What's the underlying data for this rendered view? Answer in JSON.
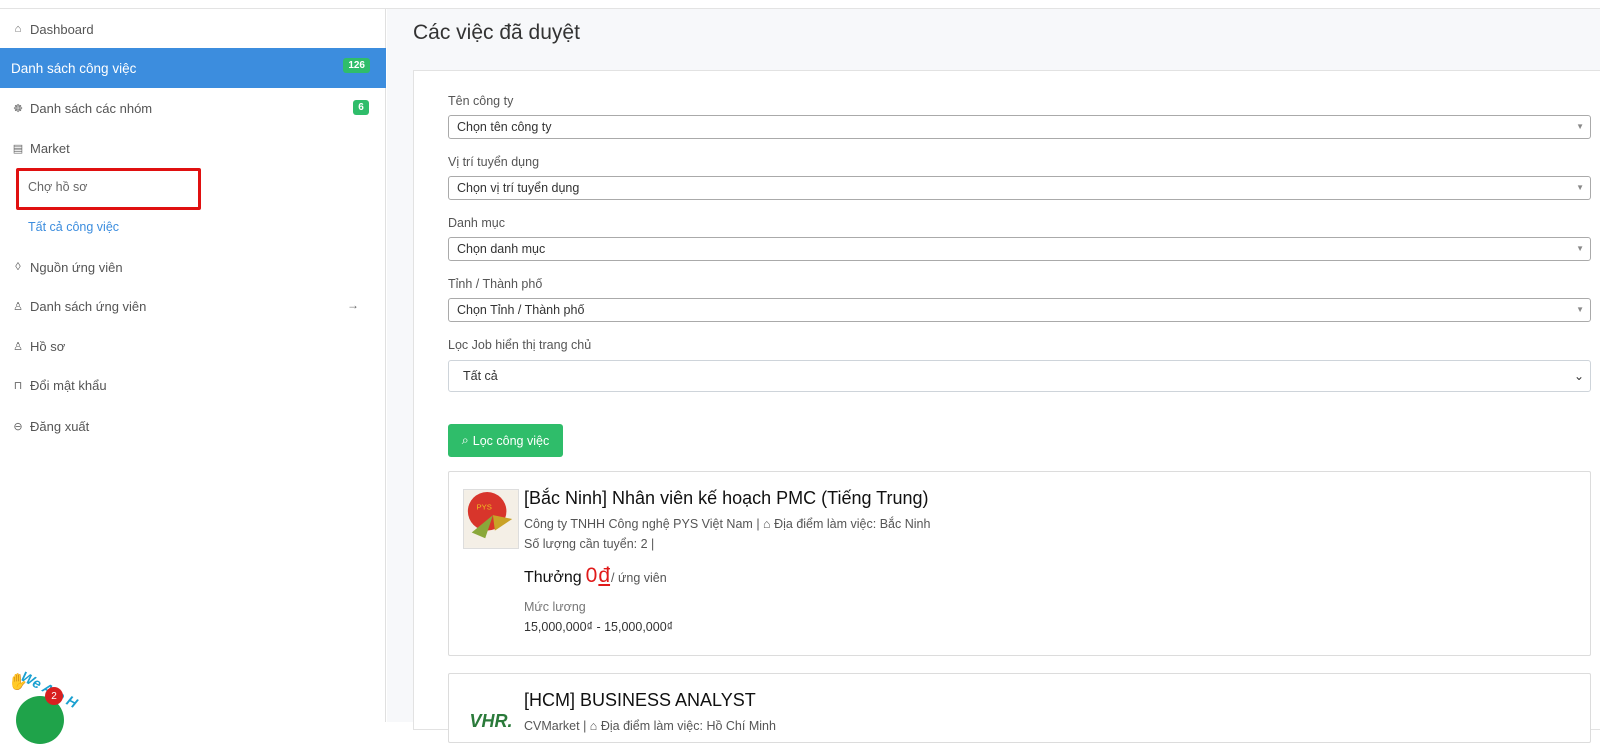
{
  "sidebar": {
    "dashboard": "Dashboard",
    "job_list": "Danh sách công việc",
    "job_list_count": "126",
    "group_list": "Danh sách các nhóm",
    "group_list_count": "6",
    "market": "Market",
    "profile_market": "Chợ hồ sơ",
    "all_jobs": "Tất cả công việc",
    "candidate_source": "Nguồn ứng viên",
    "candidate_list": "Danh sách ứng viên",
    "profile": "Hồ sơ",
    "change_password": "Đổi mật khẩu",
    "logout": "Đăng xuất",
    "notif_count": "2",
    "logo_text": "We Are H"
  },
  "main": {
    "title": "Các việc đã duyệt",
    "filters": {
      "company_label": "Tên công ty",
      "company_value": "Chọn tên công ty",
      "position_label": "Vị trí tuyển dụng",
      "position_value": "Chọn vị trí tuyển dụng",
      "category_label": "Danh mục",
      "category_value": "Chọn danh mục",
      "city_label": "Tỉnh / Thành phố",
      "city_value": "Chọn Tỉnh / Thành phố",
      "home_label": "Lọc Job hiển thị trang chủ",
      "home_value": "Tất cả",
      "filter_button": "Lọc công việc"
    },
    "jobs": [
      {
        "title": "[Bắc Ninh] Nhân viên kế hoạch PMC (Tiếng Trung)",
        "company": "Công ty TNHH Công nghệ PYS Việt Nam",
        "location_label": "Địa điểm làm việc:",
        "location": "Bắc Ninh",
        "quantity": "Số lượng cần tuyển: 2 |",
        "bonus_label": "Thưởng",
        "bonus_amount": "0",
        "bonus_unit": "đ",
        "bonus_per": "/ ứng viên",
        "salary_label": "Mức lương",
        "salary": "15,000,000₫ - 15,000,000₫",
        "logo_text": "PYS"
      },
      {
        "title": "[HCM] BUSINESS ANALYST",
        "company": "CVMarket",
        "location_label": "Địa điểm làm việc:",
        "location": "Hồ Chí Minh",
        "logo_text": "VHR."
      }
    ]
  }
}
